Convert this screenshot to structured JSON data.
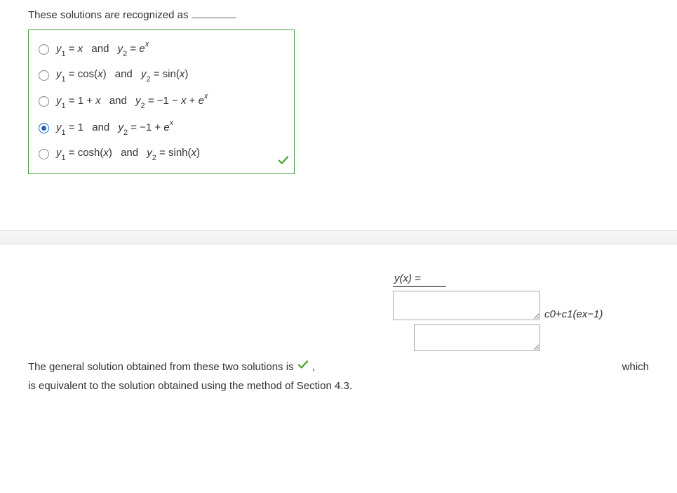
{
  "question": {
    "prompt_prefix": "These solutions are recognized as ",
    "prompt_suffix": "."
  },
  "options": {
    "selected_index": 3,
    "items": [
      {
        "y1": "x",
        "y2": "e^x"
      },
      {
        "y1": "cos(x)",
        "y2": "sin(x)"
      },
      {
        "y1": "1 + x",
        "y2": "−1 − x + e^x"
      },
      {
        "y1": "1",
        "y2": "−1 + e^x"
      },
      {
        "y1": "cosh(x)",
        "y2": "sinh(x)"
      }
    ],
    "connector": "and",
    "y1_label": "y_1",
    "y2_label": "y_2",
    "equals": " = "
  },
  "answer": {
    "lhs": "y(x) =",
    "input1_value": "",
    "input2_value": "",
    "side_display": "c0+c1(ex−1)"
  },
  "final": {
    "text_before_check": "The general solution obtained from these two solutions is ",
    "comma": " ,",
    "which": "which",
    "text_line2": "is equivalent to the solution obtained using the method of Section 4.3."
  }
}
